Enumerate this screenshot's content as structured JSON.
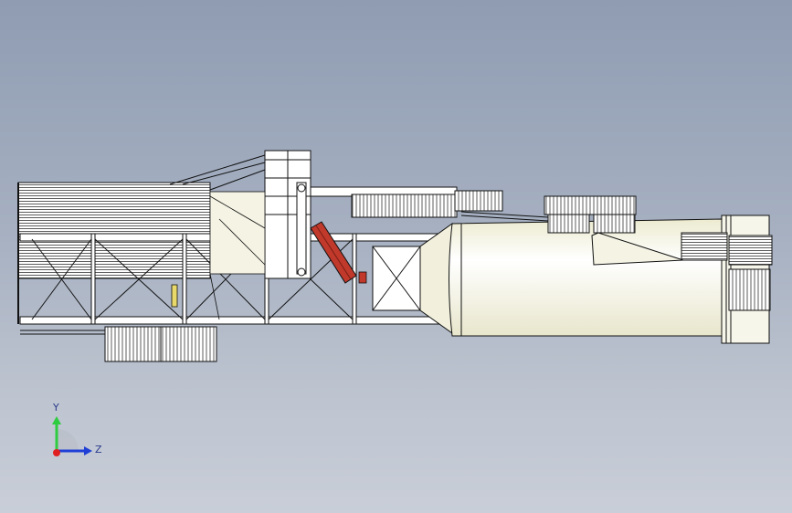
{
  "viewport": {
    "background_top": "#8f9cb2",
    "background_bottom": "#c9ced8"
  },
  "model": {
    "line_color": "#111111",
    "fill_color": "#ffffff",
    "shade_color": "#e9e6cf",
    "highlight_color": "#c0392b"
  },
  "triad": {
    "y_label": "Y",
    "z_label": "Z",
    "y_color": "#2ecc40",
    "z_color": "#1f3fd6",
    "origin_color": "#e02020"
  }
}
